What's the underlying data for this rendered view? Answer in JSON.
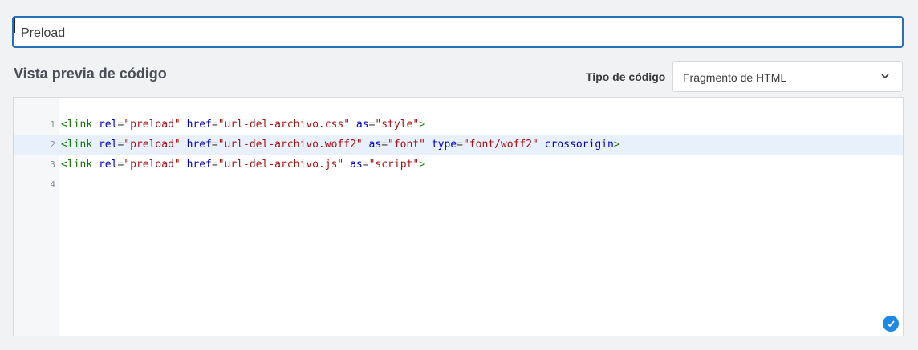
{
  "title_field": {
    "value": "Preload"
  },
  "section_title": "Vista previa de código",
  "code_type": {
    "label": "Tipo de código",
    "selected": "Fragmento de HTML"
  },
  "editor": {
    "lines": [
      {
        "num": "1",
        "active": false,
        "tokens": [
          {
            "t": "tag",
            "v": "<link"
          },
          {
            "t": "txt",
            "v": " "
          },
          {
            "t": "attr",
            "v": "rel"
          },
          {
            "t": "txt",
            "v": "="
          },
          {
            "t": "str",
            "v": "\"preload\""
          },
          {
            "t": "txt",
            "v": " "
          },
          {
            "t": "attr",
            "v": "href"
          },
          {
            "t": "txt",
            "v": "="
          },
          {
            "t": "str",
            "v": "\"url-del-archivo.css\""
          },
          {
            "t": "txt",
            "v": " "
          },
          {
            "t": "attr",
            "v": "as"
          },
          {
            "t": "txt",
            "v": "="
          },
          {
            "t": "str",
            "v": "\"style\""
          },
          {
            "t": "tag",
            "v": ">"
          }
        ]
      },
      {
        "num": "2",
        "active": true,
        "tokens": [
          {
            "t": "tag",
            "v": "<link"
          },
          {
            "t": "txt",
            "v": " "
          },
          {
            "t": "attr",
            "v": "rel"
          },
          {
            "t": "txt",
            "v": "="
          },
          {
            "t": "str",
            "v": "\"preload\""
          },
          {
            "t": "txt",
            "v": " "
          },
          {
            "t": "attr",
            "v": "href"
          },
          {
            "t": "txt",
            "v": "="
          },
          {
            "t": "str",
            "v": "\"url-del-archivo.woff2\""
          },
          {
            "t": "txt",
            "v": " "
          },
          {
            "t": "attr",
            "v": "as"
          },
          {
            "t": "txt",
            "v": "="
          },
          {
            "t": "str",
            "v": "\"font\""
          },
          {
            "t": "txt",
            "v": " "
          },
          {
            "t": "attr",
            "v": "type"
          },
          {
            "t": "txt",
            "v": "="
          },
          {
            "t": "str",
            "v": "\"font/woff2\""
          },
          {
            "t": "txt",
            "v": " "
          },
          {
            "t": "attr",
            "v": "crossorigin"
          },
          {
            "t": "tag",
            "v": ">"
          }
        ]
      },
      {
        "num": "3",
        "active": false,
        "tokens": [
          {
            "t": "tag",
            "v": "<link"
          },
          {
            "t": "txt",
            "v": " "
          },
          {
            "t": "attr",
            "v": "rel"
          },
          {
            "t": "txt",
            "v": "="
          },
          {
            "t": "str",
            "v": "\"preload\""
          },
          {
            "t": "txt",
            "v": " "
          },
          {
            "t": "attr",
            "v": "href"
          },
          {
            "t": "txt",
            "v": "="
          },
          {
            "t": "str",
            "v": "\"url-del-archivo.js\""
          },
          {
            "t": "txt",
            "v": " "
          },
          {
            "t": "attr",
            "v": "as"
          },
          {
            "t": "txt",
            "v": "="
          },
          {
            "t": "str",
            "v": "\"script\""
          },
          {
            "t": "tag",
            "v": ">"
          }
        ]
      },
      {
        "num": "4",
        "active": false,
        "tokens": []
      }
    ]
  },
  "icons": {
    "dropdown": "chevron-down-icon",
    "status": "check-circle-icon"
  },
  "colors": {
    "accent": "#2b6fb7",
    "status": "#1e88e5",
    "tag": "#117700",
    "attr": "#0000cc",
    "string": "#aa1111"
  }
}
